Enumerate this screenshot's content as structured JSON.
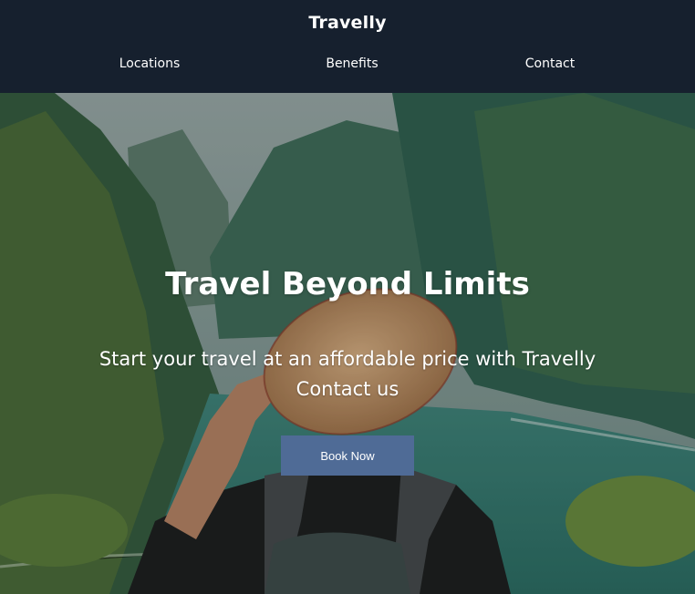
{
  "header": {
    "brand": "Travelly",
    "nav": [
      {
        "label": "Locations"
      },
      {
        "label": "Benefits"
      },
      {
        "label": "Contact"
      }
    ]
  },
  "hero": {
    "title": "Travel Beyond Limits",
    "subtitle": "Start your travel at an affordable price with Travelly Contact us",
    "cta_label": "Book Now"
  },
  "colors": {
    "header_bg": "#16202e",
    "button_bg": "#4f6b96",
    "text": "#ffffff"
  }
}
